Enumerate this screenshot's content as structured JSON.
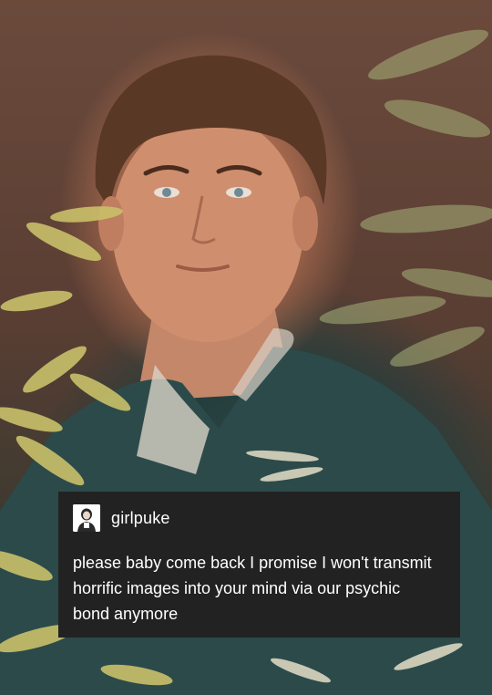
{
  "post": {
    "username": "girlpuke",
    "avatar_icon": "user-avatar-icon",
    "text": "please baby come back I promise I won't transmit horrific images into your mind via our psychic bond anymore"
  },
  "colors": {
    "card_background": "#222222",
    "card_text": "#ffffff"
  }
}
